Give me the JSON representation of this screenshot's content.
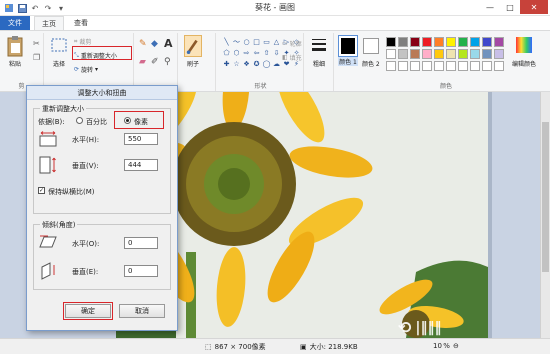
{
  "titlebar": {
    "title": "葵花 - 画图"
  },
  "tabs": {
    "file": "文件",
    "home": "主页",
    "view": "查看"
  },
  "ribbon": {
    "paste": "粘贴",
    "select": "选择",
    "crop": "裁剪",
    "resize": "重新调整大小",
    "rotate": "旋转",
    "brush": "刷子",
    "outline": "轮廓",
    "fill": "填充",
    "size": "粗细",
    "color1": "颜色 1",
    "color2": "颜色 2",
    "edit_colors": "编辑颜色",
    "group_clipboard": "剪",
    "group_shapes": "形状",
    "group_colors": "颜色",
    "shapes": [
      "╲",
      "〜",
      "○",
      "□",
      "▭",
      "△",
      "▷",
      "◇",
      "⬠",
      "⬡",
      "⇨",
      "⇦",
      "⇧",
      "⇩",
      "✦",
      "✧",
      "✚",
      "☆",
      "❖",
      "✪",
      "◯",
      "☁",
      "❤",
      "⚡"
    ],
    "palette": [
      "#000000",
      "#7f7f7f",
      "#880015",
      "#ed1c24",
      "#ff7f27",
      "#fff200",
      "#22b14c",
      "#00a2e8",
      "#3f48cc",
      "#a349a4",
      "#ffffff",
      "#c3c3c3",
      "#b97a57",
      "#ffaec9",
      "#ffc90e",
      "#efe4b0",
      "#b5e61d",
      "#99d9ea",
      "#7092be",
      "#c8bfe7",
      "#ffffff",
      "#ffffff",
      "#ffffff",
      "#ffffff",
      "#ffffff",
      "#ffffff",
      "#ffffff",
      "#ffffff",
      "#ffffff",
      "#ffffff"
    ]
  },
  "dialog": {
    "title": "调整大小和扭曲",
    "resize_group": "重新调整大小",
    "by_label": "依据(B):",
    "percent_label": "百分比",
    "pixels_label": "像素",
    "horizontal_label": "水平(H):",
    "horizontal_value": "550",
    "vertical_label": "垂直(V):",
    "vertical_value": "444",
    "keep_ratio_label": "保持纵横比(M)",
    "skew_group": "倾斜(角度)",
    "skew_h_label": "水平(O):",
    "skew_h_value": "0",
    "skew_v_label": "垂直(E):",
    "skew_v_value": "0",
    "ok": "确定",
    "cancel": "取消"
  },
  "statusbar": {
    "dimensions": "867 × 700像素",
    "filesize": "大小: 218.9KB",
    "zoom": "10 %"
  },
  "colors": {
    "accent": "#2b69c1",
    "highlight": "#d8262b"
  }
}
